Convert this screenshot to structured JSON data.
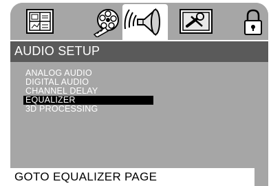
{
  "title": "AUDIO SETUP",
  "tabs": [
    {
      "icon": "general-setup-icon"
    },
    {
      "icon": "video-film-icon"
    },
    {
      "icon": "audio-speaker-icon",
      "active": true
    },
    {
      "icon": "preferences-tools-icon"
    },
    {
      "icon": "password-lock-icon"
    }
  ],
  "menu": {
    "items": [
      {
        "label": "ANALOG AUDIO"
      },
      {
        "label": "DIGITAL AUDIO"
      },
      {
        "label": "CHANNEL DELAY"
      },
      {
        "label": "EQUALIZER",
        "selected": true
      },
      {
        "label": "3D PROCESSING"
      }
    ]
  },
  "status": {
    "text": "GOTO EQUALIZER PAGE"
  },
  "colors": {
    "panel": "#a6a6a6",
    "title_bar": "#5a5a5a",
    "selection": "#000000",
    "status_bar": "#ffffff"
  }
}
